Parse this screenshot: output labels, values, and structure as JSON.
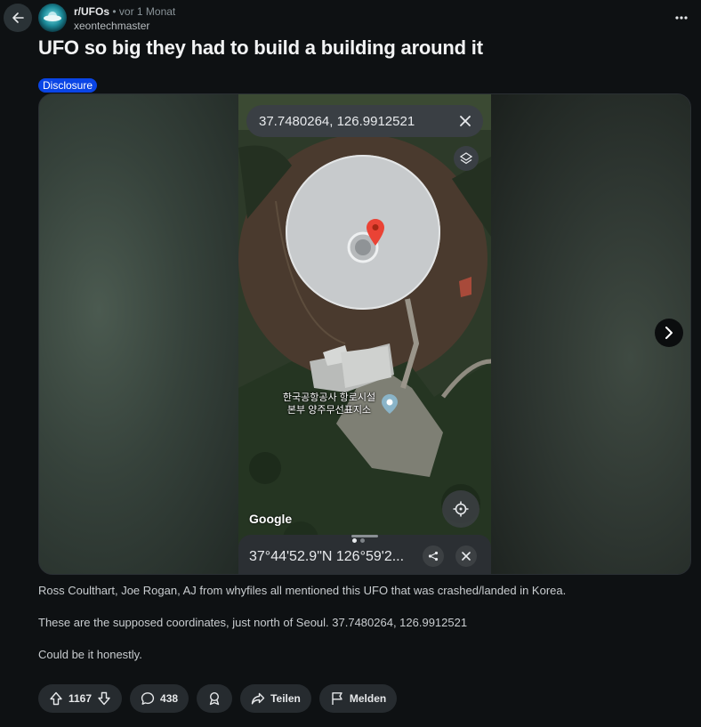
{
  "post": {
    "subreddit": "r/UFOs",
    "time": "vor 1 Monat",
    "author": "xeontechmaster",
    "title": "UFO so big they had to build a building around it",
    "flair": "Disclosure",
    "body": [
      "Ross Coulthart, Joe Rogan, AJ from whyfiles all mentioned this UFO that was crashed/landed in Korea.",
      "These are the supposed coordinates, just north of Seoul. 37.7480264, 126.9912521",
      "Could be it honestly."
    ]
  },
  "map": {
    "search_value": "37.7480264, 126.9912521",
    "place_label_line1": "한국공항공사 항로시설",
    "place_label_line2": "본부 양주무선표지소",
    "google": "Google",
    "dms": "37°44'52.9\"N 126°59'2..."
  },
  "actions": {
    "votes": "1167",
    "comments": "438",
    "share": "Teilen",
    "report": "Melden"
  },
  "colors": {
    "background": "#0e1113",
    "flair": "#0a45e6",
    "pill": "#262b2f",
    "pin": "#ea4335"
  },
  "icons": [
    "back-arrow-icon",
    "more-options-icon",
    "close-icon",
    "layers-icon",
    "location-pin-icon",
    "place-marker-icon",
    "my-location-icon",
    "share-icon",
    "chevron-right-icon",
    "upvote-icon",
    "downvote-icon",
    "comment-icon",
    "award-icon",
    "share-arrow-icon",
    "flag-icon"
  ]
}
